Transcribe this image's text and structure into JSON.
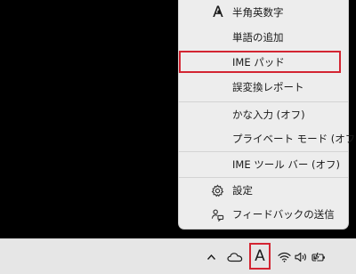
{
  "ime_menu": {
    "items": [
      {
        "label": "半角英数字",
        "mark": "•",
        "glyph": "A"
      },
      {
        "label": "単語の追加"
      },
      {
        "label": "IME パッド"
      },
      {
        "label": "誤変換レポート"
      },
      {
        "label": "かな入力 (オフ)"
      },
      {
        "label": "プライベート モード (オフ)"
      },
      {
        "label": "IME ツール バー (オフ)"
      },
      {
        "label": "設定",
        "icon": "gear-icon"
      },
      {
        "label": "フィードバックの送信",
        "icon": "feedback-icon"
      }
    ],
    "highlighted_item": "IME パッド"
  },
  "taskbar": {
    "chevron": "^",
    "ime_mode_glyph": "A",
    "icons": [
      "chevron-up-icon",
      "onedrive-cloud-icon",
      "ime-mode-icon",
      "wifi-icon",
      "volume-icon",
      "battery-charging-icon"
    ]
  },
  "colors": {
    "menu_bg": "#ededed",
    "taskbar_bg": "#e6e6e6",
    "desktop_bg": "#000000",
    "highlight_outline": "#d32532"
  }
}
